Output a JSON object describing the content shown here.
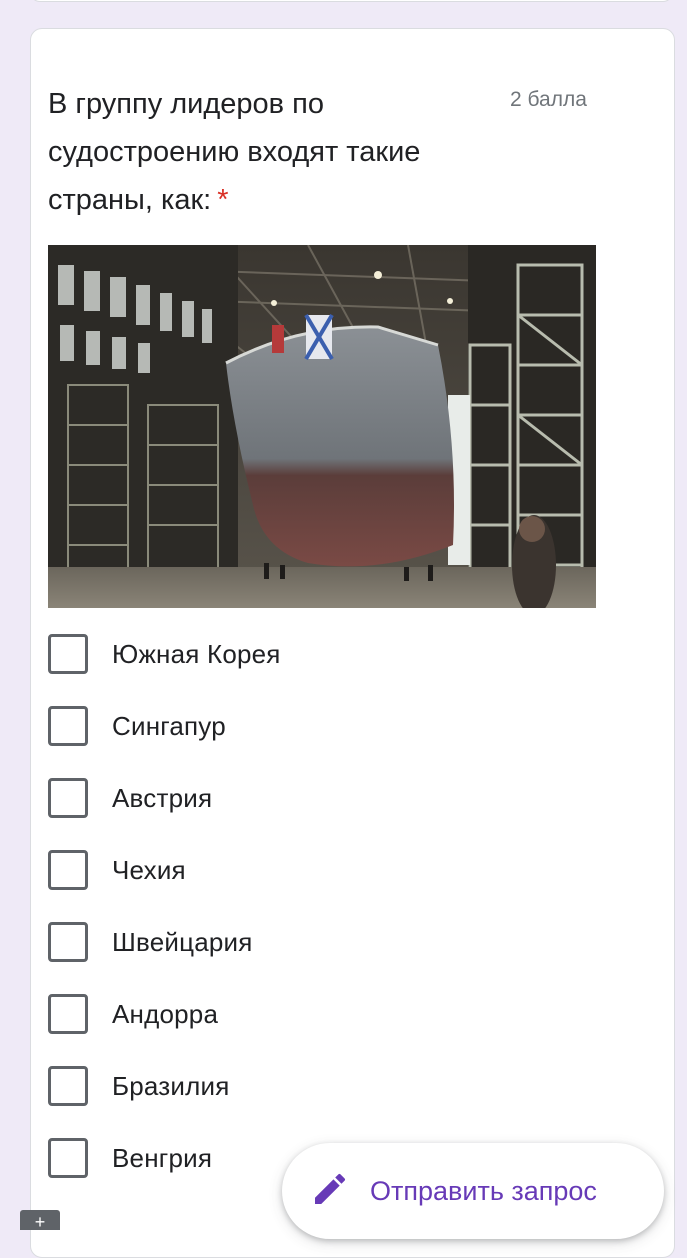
{
  "question": {
    "text": "В группу лидеров по судостроению входят такие страны, как:",
    "required_mark": "*",
    "points": "2 балла"
  },
  "image": {
    "description_icon": "shipyard-photo"
  },
  "options": [
    {
      "label": "Южная Корея",
      "checked": false
    },
    {
      "label": "Сингапур",
      "checked": false
    },
    {
      "label": "Австрия",
      "checked": false
    },
    {
      "label": "Чехия",
      "checked": false
    },
    {
      "label": "Швейцария",
      "checked": false
    },
    {
      "label": "Андорра",
      "checked": false
    },
    {
      "label": "Бразилия",
      "checked": false
    },
    {
      "label": "Венгрия",
      "checked": false
    }
  ],
  "fab": {
    "label": "Отправить запрос",
    "icon": "pencil-icon"
  },
  "colors": {
    "accent": "#673ab7",
    "required": "#d93025",
    "background": "#efeaf7"
  }
}
